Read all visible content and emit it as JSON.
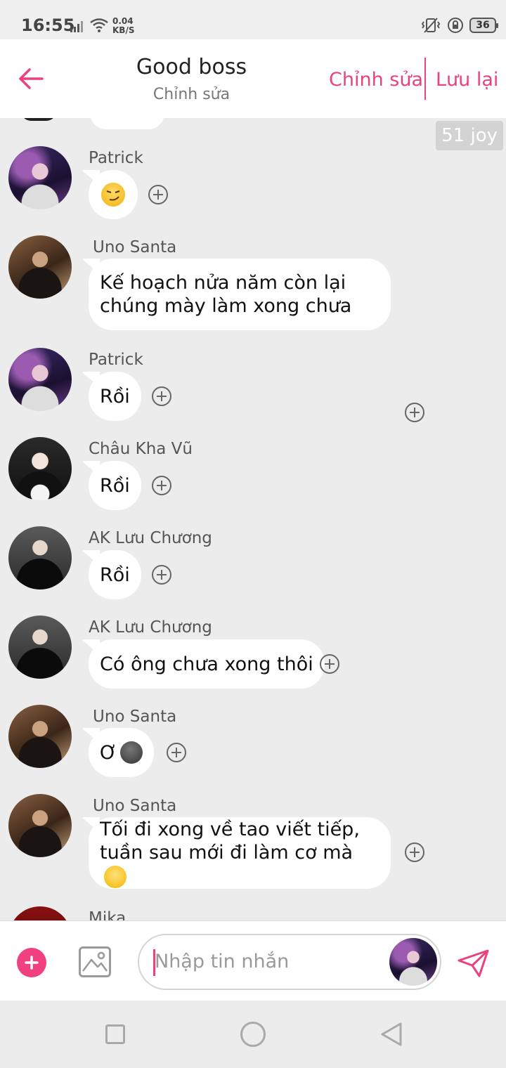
{
  "status_bar": {
    "time": "16:55",
    "net_speed_value": "0.04",
    "net_speed_unit": "KB/S",
    "battery": "36"
  },
  "header": {
    "title": "Good boss",
    "subtitle": "Chỉnh sửa",
    "edit_label": "Chỉnh sửa",
    "save_label": "Lưu lại"
  },
  "chat": {
    "badge": "51 joy",
    "messages": [
      {
        "sender": "Patrick",
        "text": "",
        "emoji": "smirk-emoji"
      },
      {
        "sender": "Uno Santa",
        "text": "Kế hoạch nửa năm còn lại chúng mày làm xong chưa"
      },
      {
        "sender": "Patrick",
        "text": "Rồi"
      },
      {
        "sender": "Châu Kha Vũ",
        "text": "Rồi"
      },
      {
        "sender": "AK Lưu Chương",
        "text": "Rồi"
      },
      {
        "sender": "AK Lưu Chương",
        "text": "Có ông chưa xong thôi"
      },
      {
        "sender": "Uno Santa",
        "text": "Ơ",
        "emoji": "dark-face-emoji"
      },
      {
        "sender": "Uno Santa",
        "text": "Tối đi xong về tao viết tiếp, tuần sau mới đi làm cơ mà",
        "emoji": "slight-smile-emoji"
      },
      {
        "sender": "Mika",
        "text": ""
      }
    ]
  },
  "input": {
    "placeholder": "Nhập tin nhắn"
  },
  "colors": {
    "accent": "#e8437f",
    "background": "#ececec",
    "bubble": "#ffffff"
  }
}
